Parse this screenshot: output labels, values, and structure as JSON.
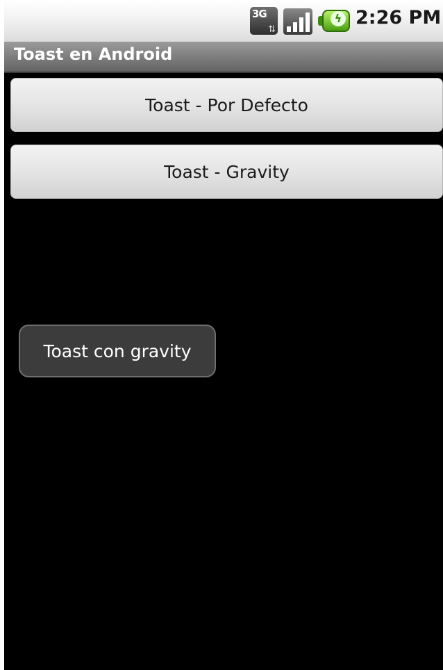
{
  "status_bar": {
    "network_label": "3G",
    "network_icon": "3g-data-icon",
    "signal_icon": "signal-strength-icon",
    "signal_level": 1.0,
    "battery_icon": "battery-charging-icon",
    "time": "2:26 PM"
  },
  "app": {
    "title": "Toast en Android"
  },
  "buttons": {
    "default_label": "Toast - Por Defecto",
    "gravity_label": "Toast - Gravity"
  },
  "toast": {
    "message": "Toast con gravity"
  },
  "colors": {
    "screen_background": "#000000",
    "title_bar": "#7e7e7e",
    "toast_background": "#3c3c3c",
    "battery_green": "#4aa010"
  }
}
